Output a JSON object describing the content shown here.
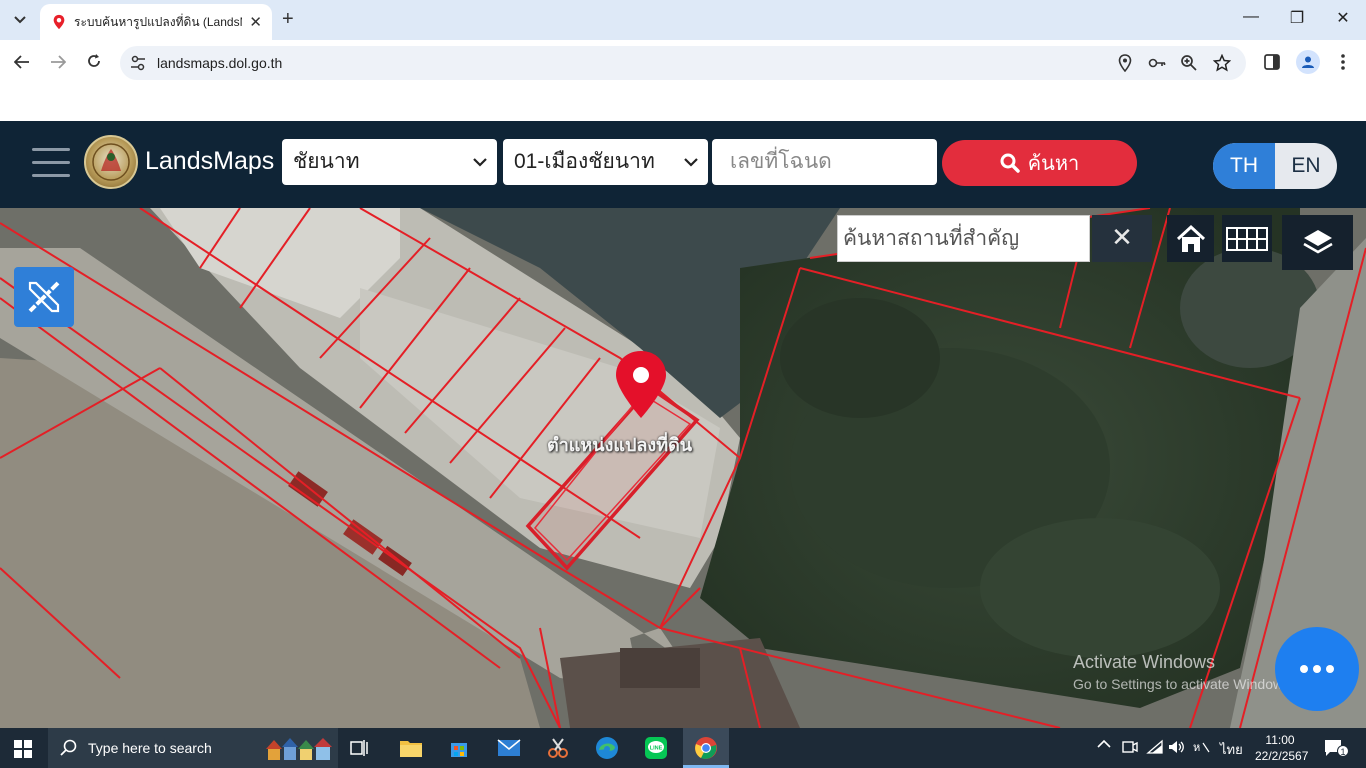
{
  "browser": {
    "tab_title": "ระบบค้นหารูปแปลงที่ดิน (LandsMaps)",
    "new_tab_label": "+",
    "url": "landsmaps.dol.go.th",
    "window_controls": {
      "minimize": "—",
      "restore": "❐",
      "close": "✕"
    }
  },
  "header": {
    "brand": "LandsMaps",
    "province": "ชัยนาท",
    "district": "01-เมืองชัยนาท",
    "deed_placeholder": "เลขที่โฉนด",
    "search_label": "ค้นหา",
    "lang_th": "TH",
    "lang_en": "EN"
  },
  "map": {
    "place_search_placeholder": "ค้นหาสถานที่สำคัญ",
    "clear_label": "✕",
    "parcel_label": "ตำแหน่งแปลงที่ดิน",
    "parcel_color": "#e8202a",
    "pin_color": "#e4102a"
  },
  "system": {
    "activation_title": "Activate Windows",
    "activation_sub": "Go to Settings to activate Windows."
  },
  "taskbar": {
    "search_text": "Type here to search",
    "tray_lang": "ไทย",
    "time": "11:00",
    "date": "22/2/2567",
    "notification_count": "1"
  },
  "colors": {
    "header_bg": "#0f2436",
    "search_red": "#e32d3d",
    "accent_blue": "#2f7fd8"
  }
}
